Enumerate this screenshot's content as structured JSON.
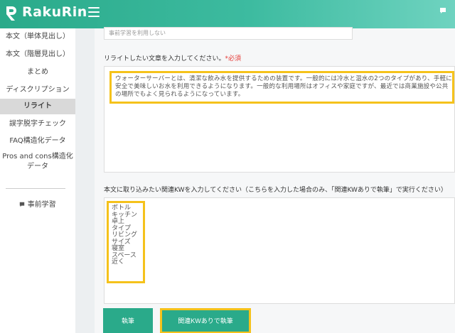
{
  "header": {
    "brand": "RakuRin",
    "menu_icon": "hamburger-menu-icon",
    "accent_color": "#2aaa8a"
  },
  "sidebar": {
    "items": [
      {
        "label": "本文（単体見出し）"
      },
      {
        "label": "本文（階層見出し）"
      },
      {
        "label": "まとめ"
      },
      {
        "label": "ディスクリプション"
      },
      {
        "label": "リライト",
        "active": true
      },
      {
        "label": "誤字脱字チェック"
      },
      {
        "label": "FAQ構造化データ"
      },
      {
        "label": "Pros and cons構造化データ"
      }
    ],
    "prelearning": "事前学習"
  },
  "form": {
    "prev_field_value": "事前学習を利用しない",
    "rewrite_label": "リライトしたい文章を入力してください。",
    "required_mark": "*必須",
    "rewrite_text": "ウォーターサーバーとは、清潔な飲み水を提供するための装置です。一般的には冷水と温水の2つのタイプがあり、手軽に安全で美味しいお水を利用できるようになります。一般的な利用場所はオフィスや家庭ですが、最近では商業施設や公共の場所でもよく見られるようになっています。",
    "keyword_label": "本文に取り込みたい関連KWを入力してください（こちらを入力した場合のみ、「関連KWありで執筆」で実行ください）",
    "keywords": [
      "ボトル",
      "キッチン",
      "卓上",
      "タイプ",
      "リビング",
      "サイズ",
      "寝室",
      "スペース",
      "近く"
    ],
    "run_button": "執筆",
    "run_with_kw_button": "関連KWありで執筆"
  }
}
